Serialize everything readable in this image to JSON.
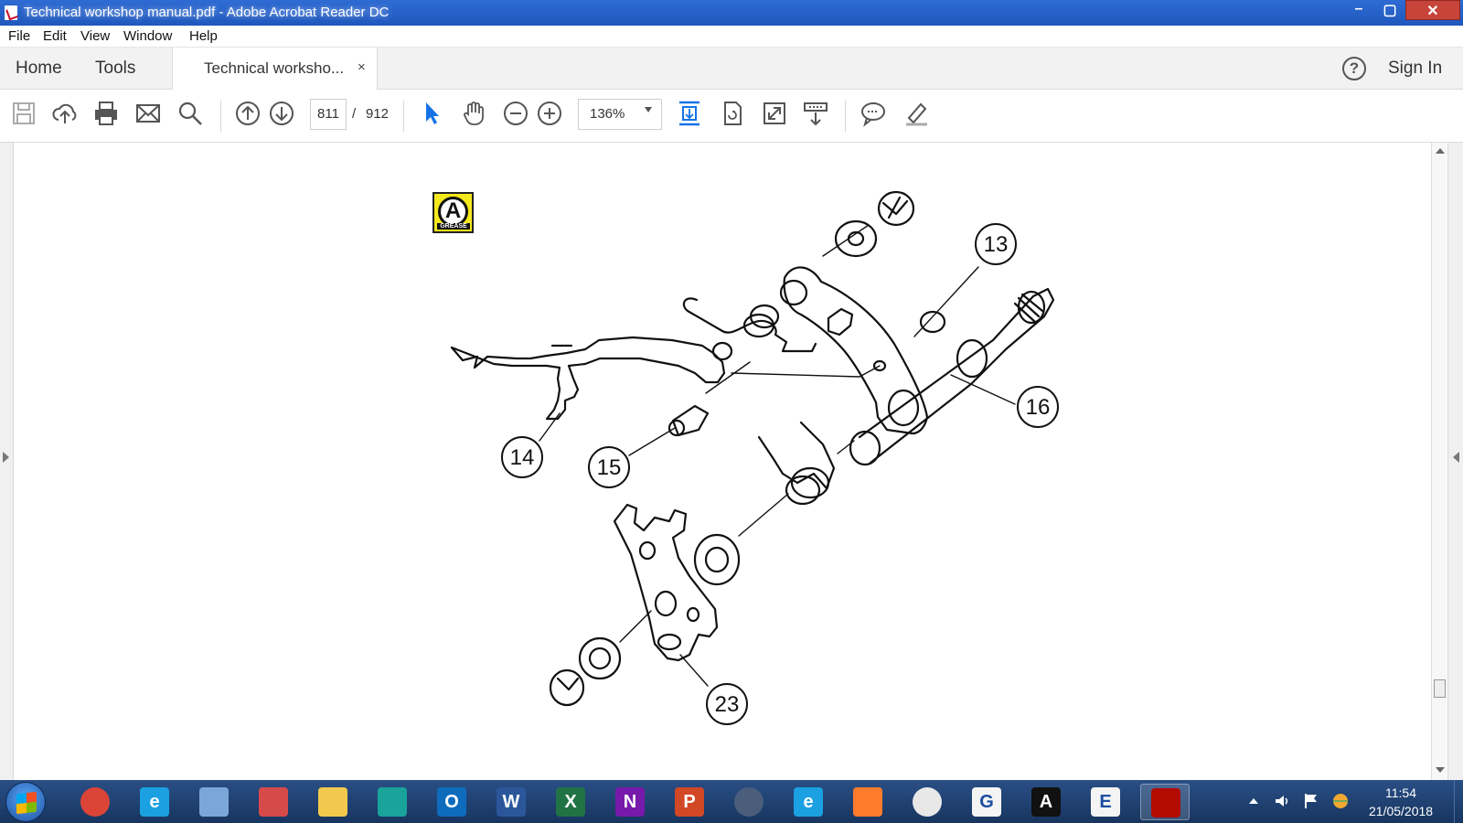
{
  "window": {
    "title": "Technical workshop manual.pdf - Adobe Acrobat Reader DC",
    "controls": {
      "minimize": "–",
      "maximize": "▢",
      "close": "✕"
    }
  },
  "menu": [
    "File",
    "Edit",
    "View",
    "Window",
    "Help"
  ],
  "tabs": {
    "home": "Home",
    "tools": "Tools",
    "document": "Technical worksho...",
    "close": "×",
    "help": "?",
    "sign_in": "Sign In"
  },
  "toolbar": {
    "current_page": "811",
    "separator": "/",
    "total_pages": "912",
    "zoom": "136%",
    "icons": [
      "save-icon",
      "upload-icon",
      "print-icon",
      "email-icon",
      "search-icon",
      "page-up-icon",
      "page-down-icon",
      "select-icon",
      "hand-icon",
      "zoom-out-icon",
      "zoom-in-icon",
      "fit-page-icon",
      "rotate-icon",
      "fullscreen-icon",
      "scroll-mode-icon",
      "comment-icon",
      "highlight-icon"
    ]
  },
  "document": {
    "badge": {
      "letter": "A",
      "text": "GREASE"
    },
    "callouts": [
      "13",
      "14",
      "15",
      "16",
      "23"
    ]
  },
  "taskbar": {
    "apps": [
      {
        "name": "chrome",
        "label": "",
        "color": "#db4437"
      },
      {
        "name": "internet-explorer",
        "label": "e",
        "color": "#1ba1e2"
      },
      {
        "name": "scanner",
        "label": "",
        "color": "#7aa7d8"
      },
      {
        "name": "snipping-tool",
        "label": "",
        "color": "#d74a4a"
      },
      {
        "name": "file-explorer",
        "label": "",
        "color": "#f2c94c"
      },
      {
        "name": "iris",
        "label": "",
        "color": "#1aa39a"
      },
      {
        "name": "outlook",
        "label": "O",
        "color": "#0f6cbd"
      },
      {
        "name": "word",
        "label": "W",
        "color": "#2b579a"
      },
      {
        "name": "excel",
        "label": "X",
        "color": "#217346"
      },
      {
        "name": "onenote",
        "label": "N",
        "color": "#7719aa"
      },
      {
        "name": "powerpoint",
        "label": "P",
        "color": "#d24726"
      },
      {
        "name": "mercedes",
        "label": "",
        "color": "#4a5e7c"
      },
      {
        "name": "internet-explorer-2",
        "label": "e",
        "color": "#1ba1e2"
      },
      {
        "name": "paint",
        "label": "",
        "color": "#ff7b2c"
      },
      {
        "name": "gear-app",
        "label": "",
        "color": "#e8e8e8"
      },
      {
        "name": "g-app",
        "label": "G",
        "color": "#f4f4f4"
      },
      {
        "name": "a-app",
        "label": "A",
        "color": "#111111"
      },
      {
        "name": "e-app",
        "label": "E",
        "color": "#f4f4f4"
      },
      {
        "name": "acrobat",
        "label": "",
        "color": "#b30b00"
      }
    ],
    "time": "11:54",
    "date": "21/05/2018"
  }
}
